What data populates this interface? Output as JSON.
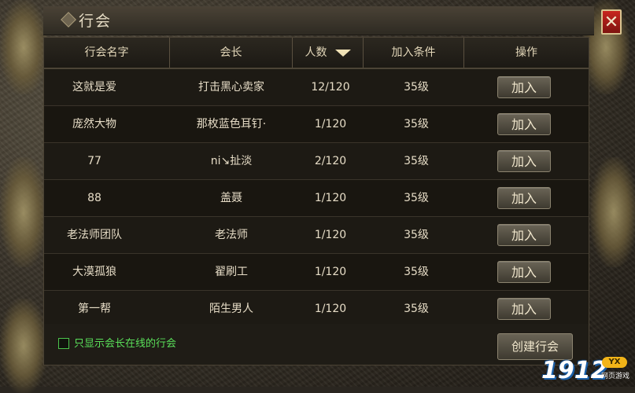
{
  "window": {
    "title": "行会",
    "close_label": "✕"
  },
  "table": {
    "headers": [
      "行会名字",
      "会长",
      "人数",
      "加入条件",
      "操作"
    ],
    "rows": [
      {
        "name": "这就是爱",
        "leader": "打击黑心卖家",
        "members": "12/120",
        "requirement": "35级",
        "action": "加入"
      },
      {
        "name": "庞然大物",
        "leader": "那枚蓝色耳钉·",
        "members": "1/120",
        "requirement": "35级",
        "action": "加入"
      },
      {
        "name": "77",
        "leader": "ni↘扯淡",
        "members": "2/120",
        "requirement": "35级",
        "action": "加入"
      },
      {
        "name": "88",
        "leader": "盖聂",
        "members": "1/120",
        "requirement": "35级",
        "action": "加入"
      },
      {
        "name": "老法师团队",
        "leader": "老法师",
        "members": "1/120",
        "requirement": "35级",
        "action": "加入"
      },
      {
        "name": "大漠孤狼",
        "leader": "翟刷工",
        "members": "1/120",
        "requirement": "35级",
        "action": "加入"
      },
      {
        "name": "第一帮",
        "leader": "陌生男人",
        "members": "1/120",
        "requirement": "35级",
        "action": "加入"
      }
    ]
  },
  "footer": {
    "filter_label": "只显示会长在线的行会",
    "filter_checked": false,
    "create_label": "创建行会"
  },
  "watermark": {
    "number": "1912",
    "badge": "YX",
    "sub": "网页游戏"
  },
  "colors": {
    "accent_green": "#5ae05a",
    "close_red": "#c8261e",
    "text": "#e6dcc6"
  },
  "icons": {
    "sort": "sort-desc-triangle-icon",
    "close": "close-icon"
  }
}
